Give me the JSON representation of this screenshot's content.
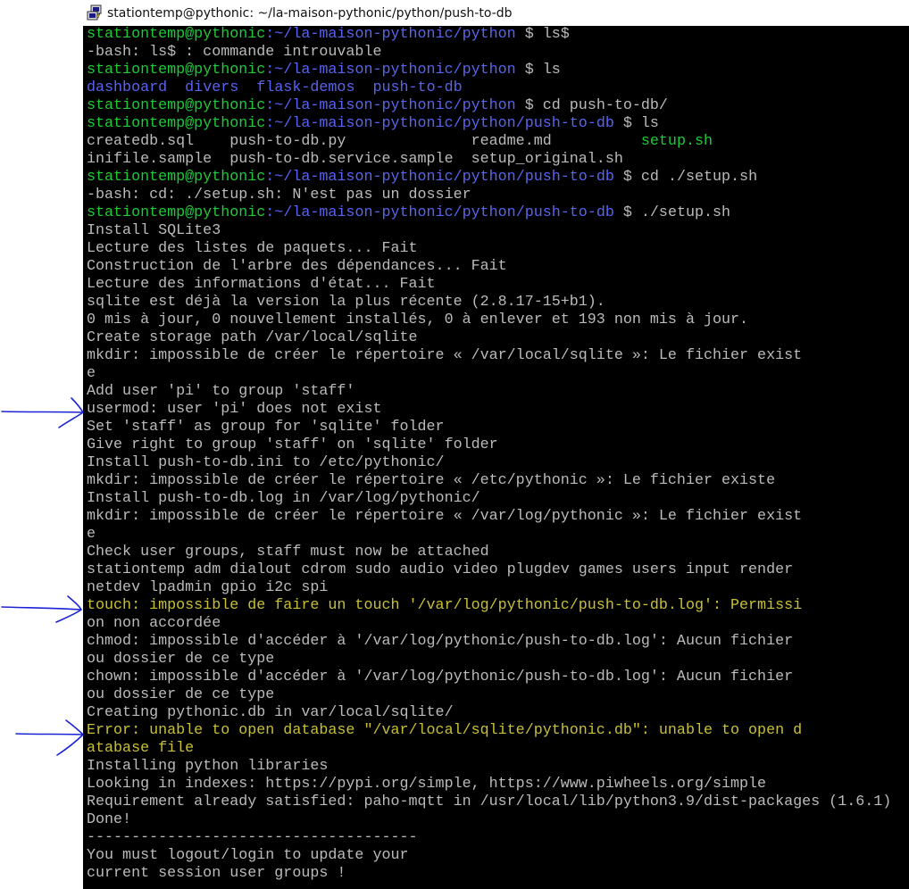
{
  "window": {
    "title": "stationtemp@pythonic: ~/la-maison-pythonic/python/push-to-db",
    "app_icon": "putty-icon"
  },
  "colors": {
    "background": "#000000",
    "text": "#bbbbbb",
    "prompt_user_host": "#1ccd38",
    "prompt_path": "#5864f2",
    "directory": "#5864f2",
    "executable": "#1ccd38",
    "highlighted_error": "#c9c033",
    "annotation_arrows": "#1a23d6"
  },
  "annotations": [
    "arrow-icon",
    "arrow-icon",
    "arrow-icon"
  ],
  "terminal": {
    "lines": [
      [
        {
          "t": "stationtemp@pythonic",
          "c": "green"
        },
        {
          "t": ":~/la-maison-pythonic/python",
          "c": "blue"
        },
        {
          "t": " $ ls$",
          "c": "gray"
        }
      ],
      [
        {
          "t": "-bash: ls$ : commande introuvable",
          "c": "gray"
        }
      ],
      [
        {
          "t": "stationtemp@pythonic",
          "c": "green"
        },
        {
          "t": ":~/la-maison-pythonic/python",
          "c": "blue"
        },
        {
          "t": " $ ls",
          "c": "gray"
        }
      ],
      [
        {
          "t": "dashboard",
          "c": "blue"
        },
        {
          "t": "  ",
          "c": "gray"
        },
        {
          "t": "divers",
          "c": "blue"
        },
        {
          "t": "  ",
          "c": "gray"
        },
        {
          "t": "flask-demos",
          "c": "blue"
        },
        {
          "t": "  ",
          "c": "gray"
        },
        {
          "t": "push-to-db",
          "c": "blue"
        }
      ],
      [
        {
          "t": "stationtemp@pythonic",
          "c": "green"
        },
        {
          "t": ":~/la-maison-pythonic/python",
          "c": "blue"
        },
        {
          "t": " $ cd push-to-db/",
          "c": "gray"
        }
      ],
      [
        {
          "t": "stationtemp@pythonic",
          "c": "green"
        },
        {
          "t": ":~/la-maison-pythonic/python/push-to-db",
          "c": "blue"
        },
        {
          "t": " $ ls",
          "c": "gray"
        }
      ],
      [
        {
          "t": "createdb.sql    push-to-db.py              readme.md          ",
          "c": "gray"
        },
        {
          "t": "setup.sh",
          "c": "green"
        }
      ],
      [
        {
          "t": "inifile.sample  push-to-db.service.sample  setup_original.sh",
          "c": "gray"
        }
      ],
      [
        {
          "t": "stationtemp@pythonic",
          "c": "green"
        },
        {
          "t": ":~/la-maison-pythonic/python/push-to-db",
          "c": "blue"
        },
        {
          "t": " $ cd ./setup.sh",
          "c": "gray"
        }
      ],
      [
        {
          "t": "-bash: cd: ./setup.sh: N'est pas un dossier",
          "c": "gray"
        }
      ],
      [
        {
          "t": "stationtemp@pythonic",
          "c": "green"
        },
        {
          "t": ":~/la-maison-pythonic/python/push-to-db",
          "c": "blue"
        },
        {
          "t": " $ ./setup.sh",
          "c": "gray"
        }
      ],
      [
        {
          "t": "Install SQLite3",
          "c": "gray"
        }
      ],
      [
        {
          "t": "Lecture des listes de paquets... Fait",
          "c": "gray"
        }
      ],
      [
        {
          "t": "Construction de l'arbre des dépendances... Fait",
          "c": "gray"
        }
      ],
      [
        {
          "t": "Lecture des informations d'état... Fait",
          "c": "gray"
        }
      ],
      [
        {
          "t": "sqlite est déjà la version la plus récente (2.8.17-15+b1).",
          "c": "gray"
        }
      ],
      [
        {
          "t": "0 mis à jour, 0 nouvellement installés, 0 à enlever et 193 non mis à jour.",
          "c": "gray"
        }
      ],
      [
        {
          "t": "Create storage path /var/local/sqlite",
          "c": "gray"
        }
      ],
      [
        {
          "t": "mkdir: impossible de créer le répertoire « /var/local/sqlite »: Le fichier exist",
          "c": "gray"
        }
      ],
      [
        {
          "t": "e",
          "c": "gray"
        }
      ],
      [
        {
          "t": "Add user 'pi' to group 'staff'",
          "c": "gray"
        }
      ],
      [
        {
          "t": "usermod: user 'pi' does not exist",
          "c": "gray"
        }
      ],
      [
        {
          "t": "Set 'staff' as group for 'sqlite' folder",
          "c": "gray"
        }
      ],
      [
        {
          "t": "Give right to group 'staff' on 'sqlite' folder",
          "c": "gray"
        }
      ],
      [
        {
          "t": "Install push-to-db.ini to /etc/pythonic/",
          "c": "gray"
        }
      ],
      [
        {
          "t": "mkdir: impossible de créer le répertoire « /etc/pythonic »: Le fichier existe",
          "c": "gray"
        }
      ],
      [
        {
          "t": "Install push-to-db.log in /var/log/pythonic/",
          "c": "gray"
        }
      ],
      [
        {
          "t": "mkdir: impossible de créer le répertoire « /var/log/pythonic »: Le fichier exist",
          "c": "gray"
        }
      ],
      [
        {
          "t": "e",
          "c": "gray"
        }
      ],
      [
        {
          "t": "Check user groups, staff must now be attached",
          "c": "gray"
        }
      ],
      [
        {
          "t": "stationtemp adm dialout cdrom sudo audio video plugdev games users input render",
          "c": "gray"
        }
      ],
      [
        {
          "t": "netdev lpadmin gpio i2c spi",
          "c": "gray"
        }
      ],
      [
        {
          "t": "touch: impossible de faire un touch '/var/log/pythonic/push-to-db.log': Permissi",
          "c": "yellow"
        }
      ],
      [
        {
          "t": "on non accordée",
          "c": "gray"
        }
      ],
      [
        {
          "t": "chmod: impossible d'accéder à '/var/log/pythonic/push-to-db.log': Aucun fichier",
          "c": "gray"
        }
      ],
      [
        {
          "t": "ou dossier de ce type",
          "c": "gray"
        }
      ],
      [
        {
          "t": "chown: impossible d'accéder à '/var/log/pythonic/push-to-db.log': Aucun fichier",
          "c": "gray"
        }
      ],
      [
        {
          "t": "ou dossier de ce type",
          "c": "gray"
        }
      ],
      [
        {
          "t": "Creating pythonic.db in var/local/sqlite/",
          "c": "gray"
        }
      ],
      [
        {
          "t": "Error: unable to open database \"/var/local/sqlite/pythonic.db\": unable to open d",
          "c": "yellow"
        }
      ],
      [
        {
          "t": "atabase file",
          "c": "yellow"
        }
      ],
      [
        {
          "t": "Installing python libraries",
          "c": "gray"
        }
      ],
      [
        {
          "t": "Looking in indexes: https://pypi.org/simple, https://www.piwheels.org/simple",
          "c": "gray"
        }
      ],
      [
        {
          "t": "Requirement already satisfied: paho-mqtt in /usr/local/lib/python3.9/dist-packages (1.6.1)",
          "c": "gray"
        }
      ],
      [
        {
          "t": "Done!",
          "c": "gray"
        }
      ],
      [
        {
          "t": "-------------------------------------",
          "c": "gray"
        }
      ],
      [
        {
          "t": "You must logout/login to update your",
          "c": "gray"
        }
      ],
      [
        {
          "t": "current session user groups !",
          "c": "gray"
        }
      ]
    ]
  }
}
